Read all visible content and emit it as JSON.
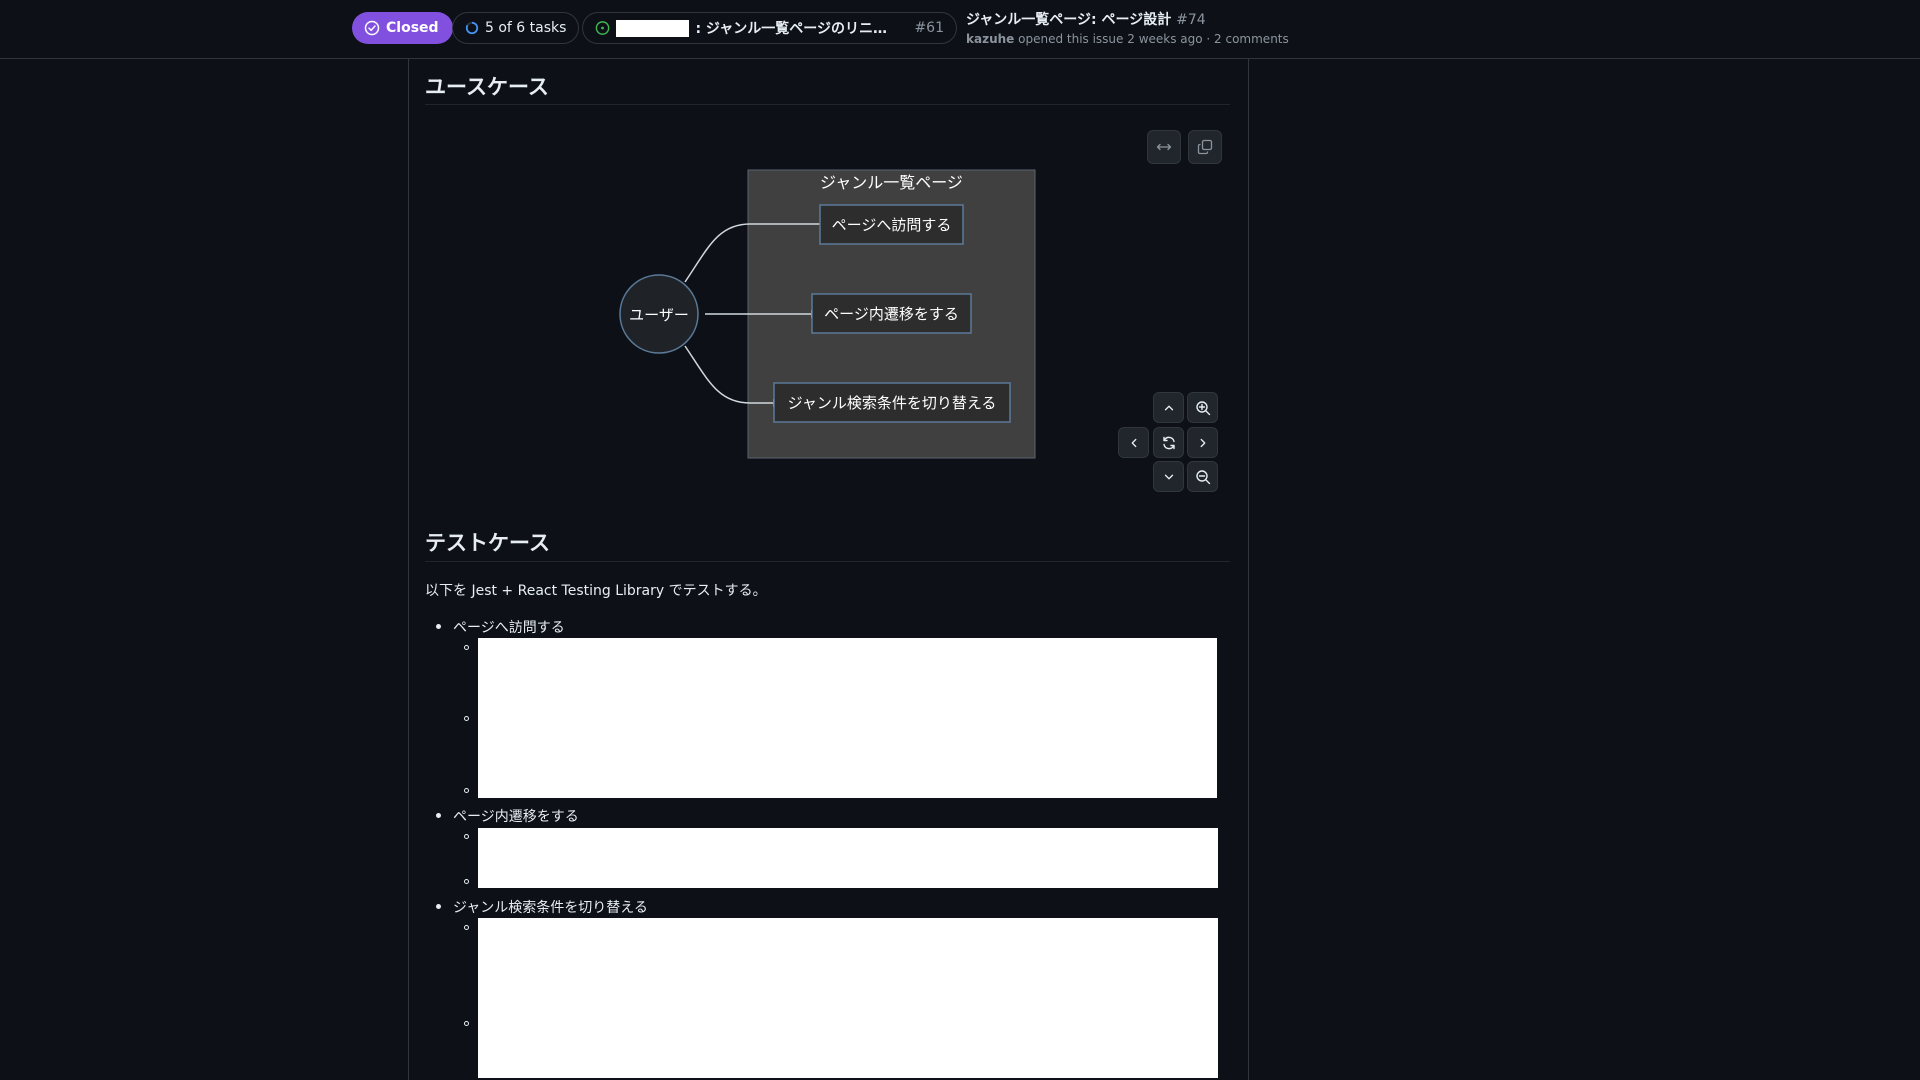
{
  "header": {
    "state_label": "Closed",
    "tasks_label": "5 of 6 tasks",
    "parent_title": ": ジャンル一覧ページのリニュー...",
    "parent_number": "#61",
    "issue_title": "ジャンル一覧ページ: ページ設計",
    "issue_number": "#74",
    "author": "kazuhe",
    "meta": "opened this issue 2 weeks ago · 2 comments",
    "colors": {
      "closed": "#8250df",
      "open": "#3fb950",
      "progress": "#4493f8"
    }
  },
  "sections": {
    "usecase_heading": "ユースケース",
    "testcase_heading": "テストケース"
  },
  "diagram": {
    "actor": "ユーザー",
    "system_title": "ジャンル一覧ページ",
    "usecases": [
      "ページへ訪問する",
      "ページ内遷移をする",
      "ジャンル検索条件を切り替える"
    ],
    "toolbar_icons": [
      "expand-icon",
      "copy-icon"
    ],
    "nav_icons": [
      "chevron-up-icon",
      "zoom-in-icon",
      "chevron-left-icon",
      "reset-icon",
      "chevron-right-icon",
      "chevron-down-icon",
      "zoom-out-icon"
    ]
  },
  "testcases": {
    "intro": "以下を Jest + React Testing Library でテストする。",
    "items": [
      {
        "label": "ページへ訪問する"
      },
      {
        "label": "ページ内遷移をする"
      },
      {
        "label": "ジャンル検索条件を切り替える"
      }
    ]
  }
}
